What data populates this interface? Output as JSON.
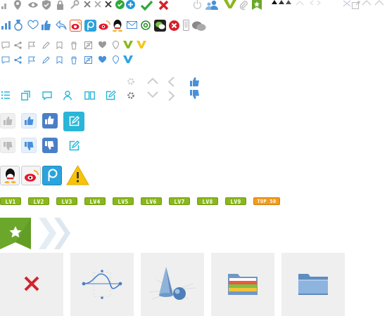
{
  "levels": [
    "LV1",
    "LV2",
    "LV3",
    "LV4",
    "LV5",
    "LV6",
    "LV7",
    "LV8",
    "LV9"
  ],
  "top_badge": "TOP 50",
  "colors": {
    "level_green": "#8ab71c",
    "top_orange": "#f29b1e",
    "accent_blue": "#4a90d9",
    "cyan": "#29b6d8",
    "red": "#d4222a",
    "green_check": "#2fa83a",
    "tile_bg": "#efefef",
    "bookmark_green": "#6aa72a",
    "verified_green": "#8ab71c",
    "verified_yellow": "#f5c518",
    "verified_blue": "#2aa5e0"
  },
  "icons": {
    "row1": [
      "location-pin-icon",
      "eye-icon",
      "shield-check-icon",
      "lock-icon",
      "wrench-icon",
      "close-icon",
      "close-icon",
      "close-icon",
      "check-circle-icon",
      "plus-circle-icon",
      "check-icon",
      "close-icon",
      "power-icon",
      "users-icon",
      "verified-v-icon",
      "paperclip-icon",
      "star-bookmark-icon",
      "chevron-icon"
    ],
    "row2": [
      "bar-chart-icon",
      "medal-icon",
      "heart-icon",
      "thumbs-up-icon",
      "reply-icon",
      "weibo-icon",
      "p-icon",
      "weibo-icon",
      "qq-icon",
      "mail-icon",
      "at-icon",
      "wechat-icon",
      "close-circle-icon",
      "phone-icon",
      "chat-icon"
    ],
    "tiles": [
      "close-icon",
      "bezier-curve-icon",
      "shapes-3d-icon",
      "folder-colorful-icon",
      "folder-blue-icon"
    ]
  }
}
